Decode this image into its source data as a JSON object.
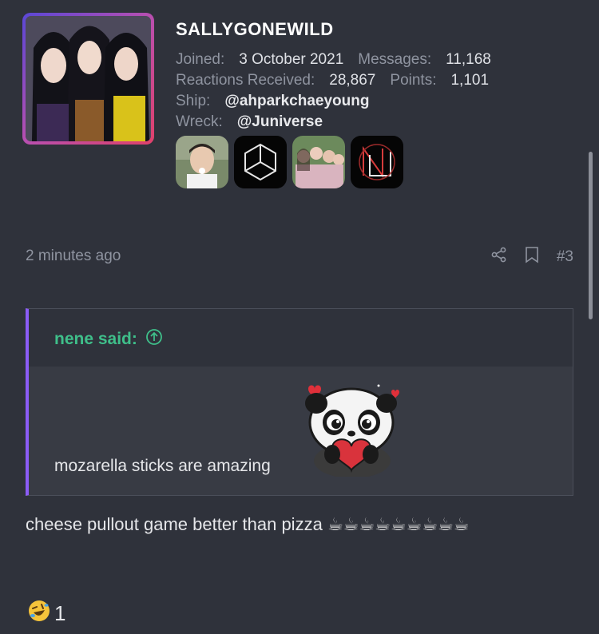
{
  "profile": {
    "username": "SALLYGONEWILD",
    "joined_label": "Joined:",
    "joined_value": "3 October 2021",
    "messages_label": "Messages:",
    "messages_value": "11,168",
    "reactions_label": "Reactions Received:",
    "reactions_value": "28,867",
    "points_label": "Points:",
    "points_value": "1,101",
    "ship_label": "Ship:",
    "ship_value": "@ahparkchaeyoung",
    "wreck_label": "Wreck:",
    "wreck_value": "@Juniverse"
  },
  "post": {
    "time": "2 minutes ago",
    "number": "#3",
    "body": "cheese pullout game better than pizza",
    "cups": "☕☕☕☕☕☕☕☕☕",
    "reaction_count": "1"
  },
  "quote": {
    "author": "nene said:",
    "text": "mozarella sticks are amazing"
  },
  "colors": {
    "background": "#2f323b",
    "quote_author": "#3fbf8a",
    "quote_border": "#8b5cf6"
  }
}
